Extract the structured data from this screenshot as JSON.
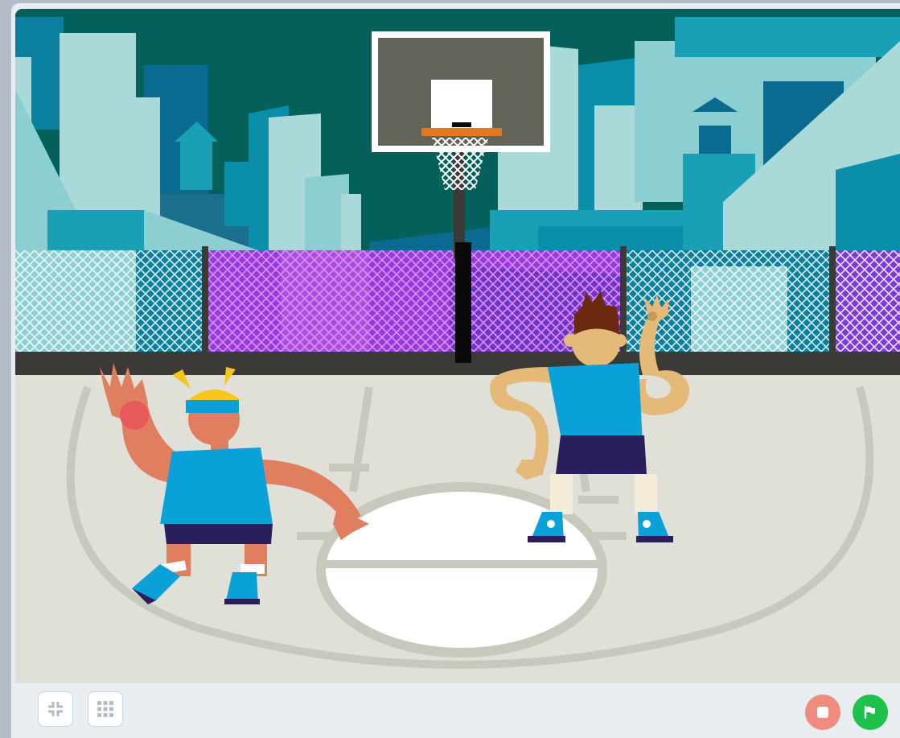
{
  "window": {
    "accent": "#e8edf1",
    "chrome": "#b3bbc6"
  },
  "stage": {
    "scene": "basketball-court",
    "sprites": [
      "player-girl",
      "player-boy",
      "basketball-hoop"
    ]
  },
  "controls": {
    "left": [
      {
        "icon": "unfullscreen-icon",
        "color": "#b3bbc6"
      },
      {
        "icon": "grid-icon",
        "color": "#b3bbc6"
      }
    ],
    "right": [
      {
        "icon": "stop-icon",
        "color": "#f08c7d"
      },
      {
        "icon": "green-flag-icon",
        "color": "#1ec14a"
      }
    ]
  }
}
